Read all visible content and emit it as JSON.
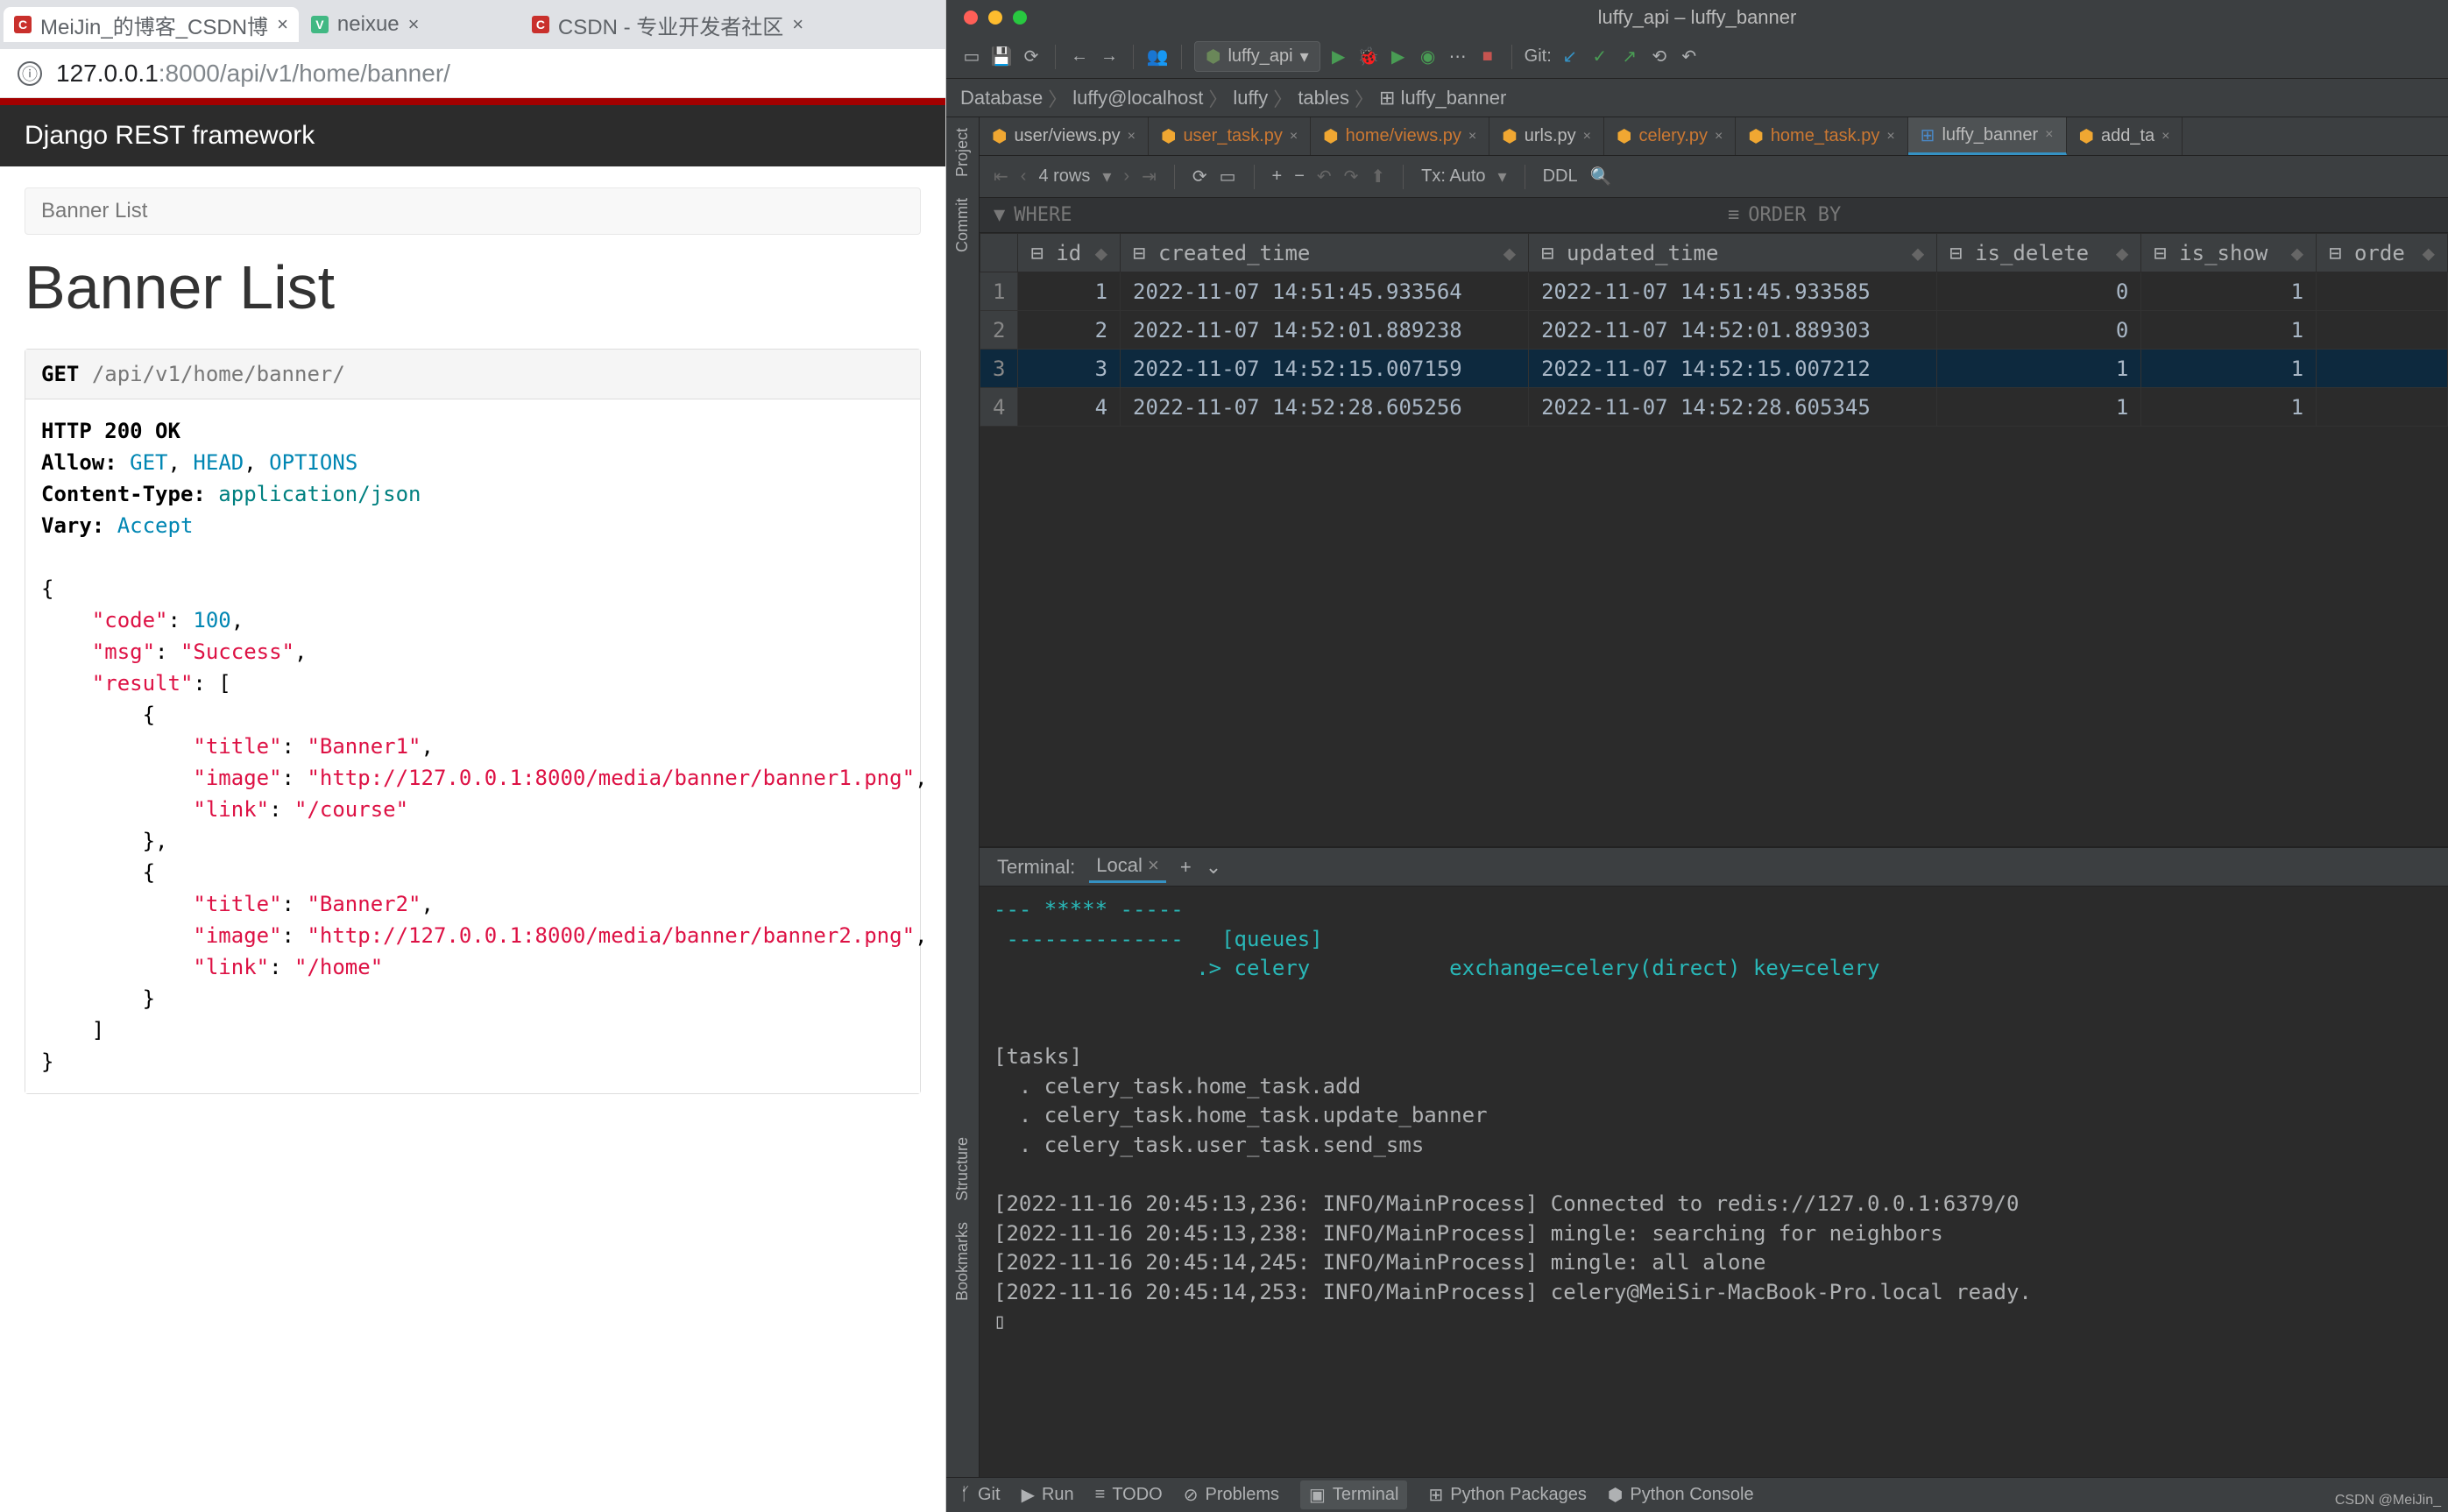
{
  "browser": {
    "tabs": [
      {
        "title": "MeiJin_的博客_CSDN博",
        "favicon": "C",
        "color": "#c9302c"
      },
      {
        "title": "neixue",
        "favicon": "V",
        "color": "#41b883"
      },
      {
        "title": "CSDN - 专业开发者社区",
        "favicon": "C",
        "color": "#c9302c"
      }
    ],
    "url_host": "127.0.0.1",
    "url_port": ":8000",
    "url_path": "/api/v1/home/banner/",
    "framework": "Django REST framework",
    "breadcrumb": "Banner List",
    "h1": "Banner List",
    "method": "GET",
    "endpoint": "/api/v1/home/banner/",
    "resp": {
      "status": "HTTP 200 OK",
      "allow_label": "Allow:",
      "allow": "GET, HEAD, OPTIONS",
      "ctype_label": "Content-Type:",
      "ctype": "application/json",
      "vary_label": "Vary:",
      "vary": "Accept",
      "code": 100,
      "msg": "Success",
      "result": [
        {
          "title": "Banner1",
          "image": "http://127.0.0.1:8000/media/banner/banner1.png",
          "link": "/course"
        },
        {
          "title": "Banner2",
          "image": "http://127.0.0.1:8000/media/banner/banner2.png",
          "link": "/home"
        }
      ]
    }
  },
  "ide": {
    "title": "luffy_api – luffy_banner",
    "runcfg": "luffy_api",
    "git_label": "Git:",
    "nav": [
      "Database",
      "luffy@localhost",
      "luffy",
      "tables",
      "luffy_banner"
    ],
    "filetabs": [
      {
        "name": "user/views.py",
        "type": "py"
      },
      {
        "name": "user_task.py",
        "type": "py",
        "orange": true
      },
      {
        "name": "home/views.py",
        "type": "py",
        "orange": true
      },
      {
        "name": "urls.py",
        "type": "py"
      },
      {
        "name": "celery.py",
        "type": "py",
        "orange": true
      },
      {
        "name": "home_task.py",
        "type": "py",
        "orange": true
      },
      {
        "name": "luffy_banner",
        "type": "db",
        "active": true
      },
      {
        "name": "add_ta",
        "type": "py"
      }
    ],
    "dbtoolbar": {
      "rows": "4 rows",
      "tx": "Tx: Auto",
      "ddl": "DDL"
    },
    "filter": {
      "where": "WHERE",
      "order": "ORDER BY"
    },
    "table": {
      "cols": [
        "id",
        "created_time",
        "updated_time",
        "is_delete",
        "is_show",
        "orde"
      ],
      "rows": [
        {
          "n": 1,
          "id": 1,
          "ct": "2022-11-07 14:51:45.933564",
          "ut": "2022-11-07 14:51:45.933585",
          "del": 0,
          "show": 1
        },
        {
          "n": 2,
          "id": 2,
          "ct": "2022-11-07 14:52:01.889238",
          "ut": "2022-11-07 14:52:01.889303",
          "del": 0,
          "show": 1
        },
        {
          "n": 3,
          "id": 3,
          "ct": "2022-11-07 14:52:15.007159",
          "ut": "2022-11-07 14:52:15.007212",
          "del": 1,
          "show": 1,
          "sel": true
        },
        {
          "n": 4,
          "id": 4,
          "ct": "2022-11-07 14:52:28.605256",
          "ut": "2022-11-07 14:52:28.605345",
          "del": 1,
          "show": 1
        }
      ]
    },
    "terminal": {
      "label": "Terminal:",
      "tab": "Local",
      "lines": [
        {
          "c": "cyan",
          "t": "--- ***** -----"
        },
        {
          "c": "cyan",
          "t": " --------------   [queues]"
        },
        {
          "c": "cyan",
          "t": "                .> celery           exchange=celery(direct) key=celery"
        },
        {
          "c": "",
          "t": ""
        },
        {
          "c": "",
          "t": ""
        },
        {
          "c": "",
          "t": "[tasks]"
        },
        {
          "c": "",
          "t": "  . celery_task.home_task.add"
        },
        {
          "c": "",
          "t": "  . celery_task.home_task.update_banner"
        },
        {
          "c": "",
          "t": "  . celery_task.user_task.send_sms"
        },
        {
          "c": "",
          "t": ""
        },
        {
          "c": "",
          "t": "[2022-11-16 20:45:13,236: INFO/MainProcess] Connected to redis://127.0.0.1:6379/0"
        },
        {
          "c": "",
          "t": "[2022-11-16 20:45:13,238: INFO/MainProcess] mingle: searching for neighbors"
        },
        {
          "c": "",
          "t": "[2022-11-16 20:45:14,245: INFO/MainProcess] mingle: all alone"
        },
        {
          "c": "",
          "t": "[2022-11-16 20:45:14,253: INFO/MainProcess] celery@MeiSir-MacBook-Pro.local ready."
        },
        {
          "c": "",
          "t": "▯"
        }
      ]
    },
    "status": [
      {
        "icon": "git",
        "label": "Git"
      },
      {
        "icon": "run",
        "label": "Run"
      },
      {
        "icon": "todo",
        "label": "TODO"
      },
      {
        "icon": "problems",
        "label": "Problems"
      },
      {
        "icon": "terminal",
        "label": "Terminal",
        "active": true
      },
      {
        "icon": "pkg",
        "label": "Python Packages"
      },
      {
        "icon": "pycon",
        "label": "Python Console"
      }
    ],
    "side": [
      "Project",
      "Commit",
      "Structure",
      "Bookmarks"
    ]
  },
  "watermark": "CSDN @MeiJin_"
}
